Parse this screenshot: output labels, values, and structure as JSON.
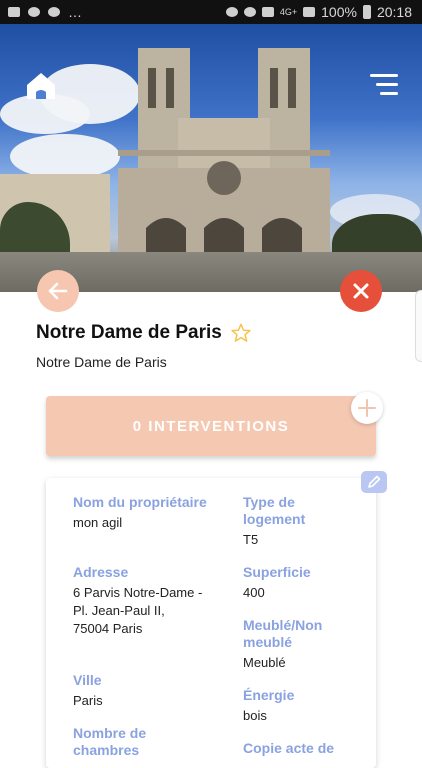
{
  "status_bar": {
    "battery_text": "100%",
    "time": "20:18",
    "signal_text": "4G+"
  },
  "header": {
    "home_icon": "house-icon",
    "menu_icon": "hamburger-menu-icon"
  },
  "actions": {
    "back_icon": "arrow-left-icon",
    "close_icon": "close-icon"
  },
  "property": {
    "title": "Notre Dame de Paris",
    "subtitle": "Notre Dame de Paris",
    "favorite_icon": "star-outline-icon"
  },
  "interventions": {
    "label": "0 INTERVENTIONS",
    "add_icon": "plus-icon"
  },
  "details": {
    "edit_icon": "pencil-icon",
    "left_column": [
      {
        "label": "Nom du propriétaire",
        "value": "mon agil"
      },
      {
        "label": "Adresse",
        "value": "6 Parvis Notre-Dame - Pl. Jean-Paul II, 75004 Paris"
      },
      {
        "label": "Ville",
        "value": "Paris"
      },
      {
        "label": "Nombre de chambres",
        "value": ""
      }
    ],
    "right_column": [
      {
        "label": "Type de logement",
        "value": "T5"
      },
      {
        "label": "Superficie",
        "value": "400"
      },
      {
        "label": "Meublé/Non meublé",
        "value": "Meublé"
      },
      {
        "label": "Énergie",
        "value": "bois"
      },
      {
        "label": "Copie acte de",
        "value": ""
      }
    ]
  },
  "colors": {
    "accent_peach": "#f5c8b2",
    "close_red": "#e6503a",
    "label_blue": "#8aa2e0"
  }
}
